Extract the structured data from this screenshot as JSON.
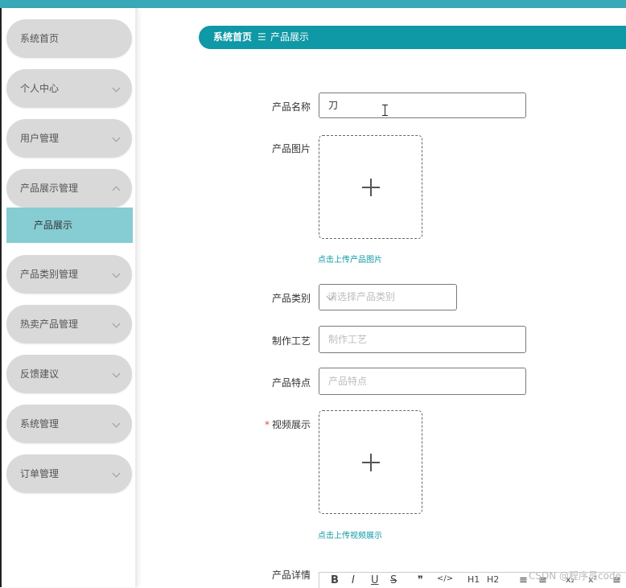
{
  "sidebar": {
    "items": [
      {
        "label": "系统首页",
        "chevron": "none"
      },
      {
        "label": "个人中心",
        "chevron": "down"
      },
      {
        "label": "用户管理",
        "chevron": "down"
      },
      {
        "label": "产品展示管理",
        "chevron": "up"
      },
      {
        "label": "产品类别管理",
        "chevron": "down"
      },
      {
        "label": "热卖产品管理",
        "chevron": "down"
      },
      {
        "label": "反馈建议",
        "chevron": "down"
      },
      {
        "label": "系统管理",
        "chevron": "down"
      },
      {
        "label": "订单管理",
        "chevron": "down"
      }
    ],
    "submenu_active": "产品展示"
  },
  "breadcrumb": {
    "home": "系统首页",
    "separator": "☰",
    "current": "产品展示"
  },
  "form": {
    "name": {
      "label": "产品名称",
      "value": "刀"
    },
    "image": {
      "label": "产品图片",
      "hint": "点击上传产品图片"
    },
    "category": {
      "label": "产品类别",
      "placeholder": "请选择产品类别"
    },
    "craft": {
      "label": "制作工艺",
      "placeholder": "制作工艺"
    },
    "feature": {
      "label": "产品特点",
      "placeholder": "产品特点"
    },
    "video": {
      "label": "视频展示",
      "required_mark": "*",
      "hint": "点击上传视频展示"
    },
    "detail": {
      "label": "产品详情"
    }
  },
  "editor_toolbar": [
    "B",
    "I",
    "U",
    "S",
    "❞",
    "</>",
    "H1",
    "H2",
    "≡",
    "≡",
    "x₂",
    "x²",
    "≡"
  ],
  "watermark": "CSDN @程序员code",
  "colors": {
    "accent": "#0f98a5",
    "submenu": "#86ccd3",
    "menu": "#d9d9d9"
  }
}
